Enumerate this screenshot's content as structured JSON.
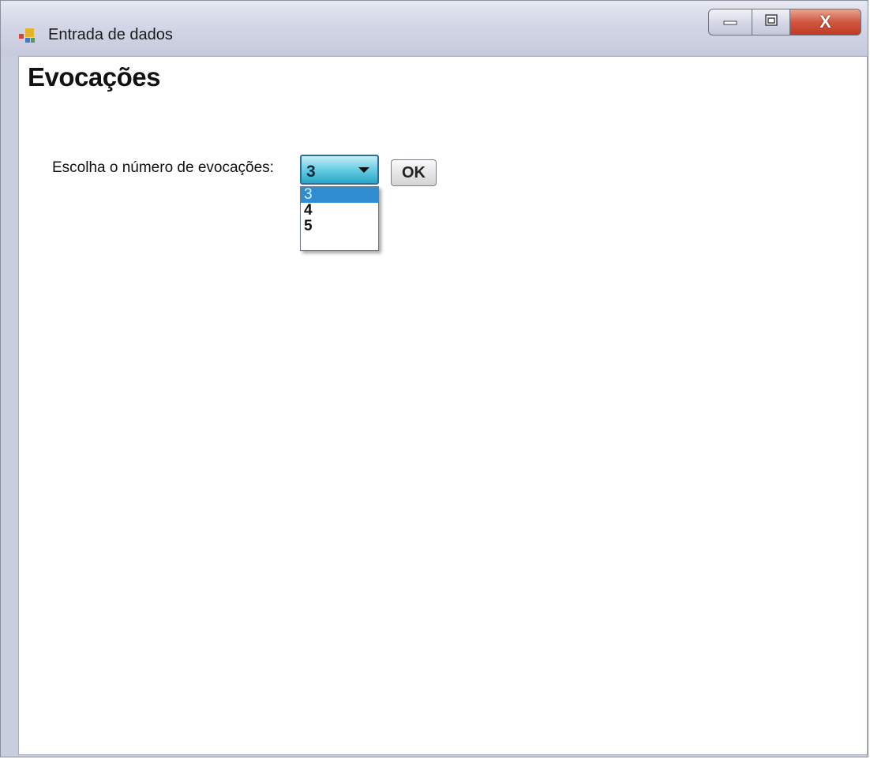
{
  "window": {
    "title": "Entrada de dados",
    "icon": "app-window-icon",
    "controls": {
      "minimize_icon": "minimize-icon",
      "maximize_icon": "maximize-icon",
      "close_label": "X"
    }
  },
  "form": {
    "heading": "Evocações",
    "prompt_label": "Escolha o número de evocações:",
    "combo": {
      "selected_value": "3",
      "options": [
        "3",
        "4",
        "5"
      ],
      "highlighted_option": "3"
    },
    "ok_label": "OK"
  },
  "colors": {
    "combo_accent": "#27a7c7",
    "selected_option_bg": "#2f8ed2",
    "close_button": "#c23a22"
  }
}
